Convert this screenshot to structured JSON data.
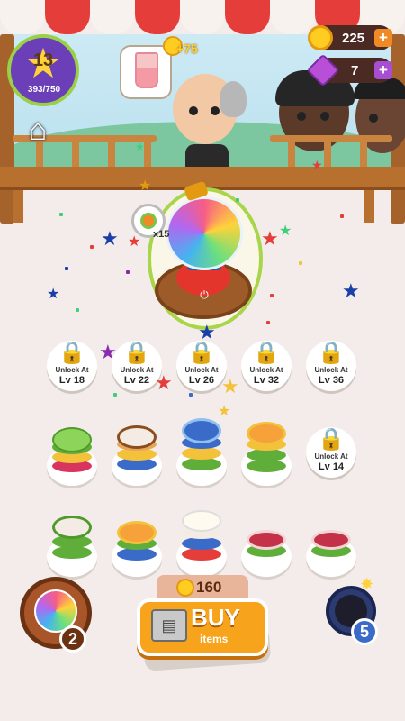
{
  "player": {
    "level": "13",
    "xp": "393/750",
    "level_icon": "star-icon"
  },
  "currency": {
    "coins": "225",
    "gems": "7"
  },
  "order": {
    "item": "bubble-tea-icon",
    "reward": "+75"
  },
  "machine": {
    "ingredient_count": "x15"
  },
  "locked_plates": [
    {
      "label": "Unlock At",
      "level": "Lv 18"
    },
    {
      "label": "Unlock At",
      "level": "Lv 22"
    },
    {
      "label": "Unlock At",
      "level": "Lv 26"
    },
    {
      "label": "Unlock At",
      "level": "Lv 32"
    },
    {
      "label": "Unlock At",
      "level": "Lv 36"
    },
    {
      "label": "Unlock At",
      "level": "Lv 14"
    }
  ],
  "boosters": {
    "potion_count": "2",
    "bomb_count": "5"
  },
  "shop": {
    "price": "160",
    "buy_label": "BUY",
    "buy_sub": "items"
  },
  "colors": {
    "accent": "#f8a31c",
    "awning_red": "#e53d3a",
    "level_ring": "#9ad045"
  }
}
